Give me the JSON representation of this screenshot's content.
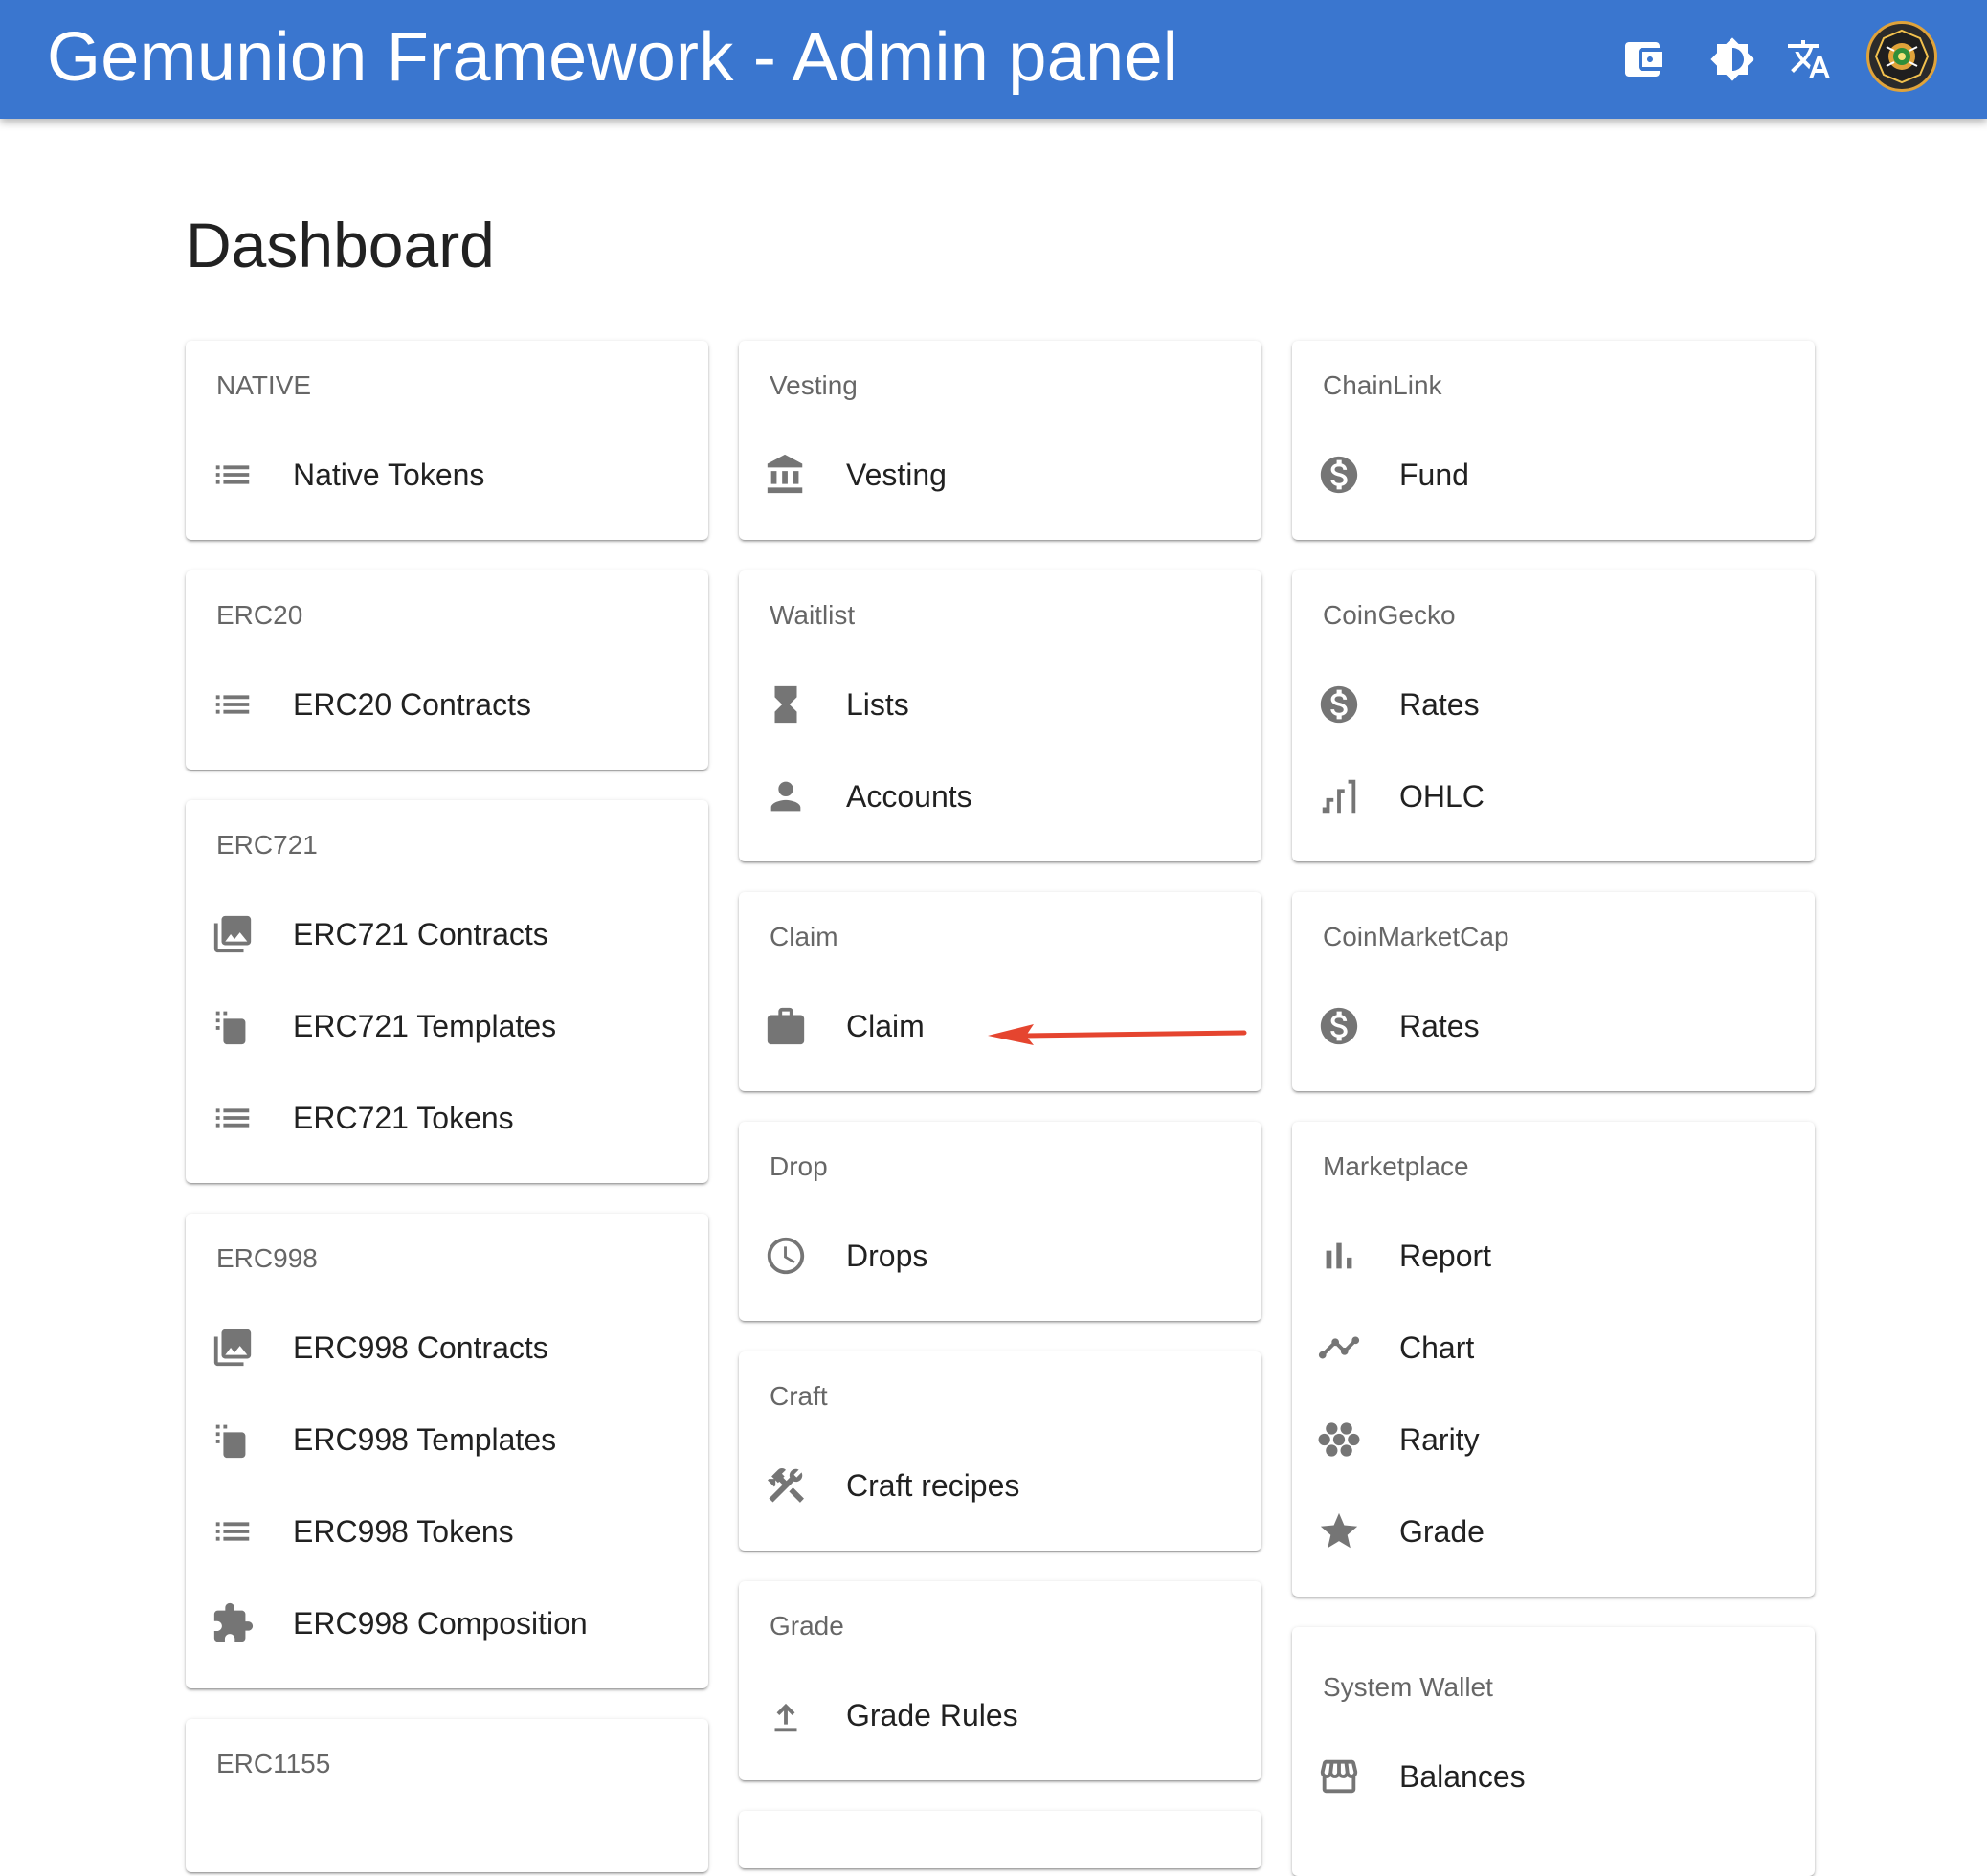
{
  "appbar": {
    "title": "Gemunion Framework - Admin panel",
    "icons": [
      "wallet-icon",
      "brightness-icon",
      "translate-icon",
      "logo-avatar"
    ]
  },
  "page": {
    "title": "Dashboard"
  },
  "annotation": {
    "arrow_color": "#e5452f",
    "points_to": "claim-item"
  },
  "columns": [
    [
      {
        "title": "NATIVE",
        "items": [
          {
            "label": "Native Tokens",
            "icon": "list-icon"
          }
        ]
      },
      {
        "title": "ERC20",
        "items": [
          {
            "label": "ERC20 Contracts",
            "icon": "list-icon"
          }
        ]
      },
      {
        "title": "ERC721",
        "items": [
          {
            "label": "ERC721 Contracts",
            "icon": "image-stack-icon"
          },
          {
            "label": "ERC721 Templates",
            "icon": "copy-icon"
          },
          {
            "label": "ERC721 Tokens",
            "icon": "list-icon"
          }
        ]
      },
      {
        "title": "ERC998",
        "items": [
          {
            "label": "ERC998 Contracts",
            "icon": "image-stack-icon"
          },
          {
            "label": "ERC998 Templates",
            "icon": "copy-icon"
          },
          {
            "label": "ERC998 Tokens",
            "icon": "list-icon"
          },
          {
            "label": "ERC998 Composition",
            "icon": "puzzle-icon"
          }
        ]
      },
      {
        "title": "ERC1155",
        "items": []
      }
    ],
    [
      {
        "title": "Vesting",
        "items": [
          {
            "label": "Vesting",
            "icon": "bank-icon"
          }
        ]
      },
      {
        "title": "Waitlist",
        "items": [
          {
            "label": "Lists",
            "icon": "hourglass-icon"
          },
          {
            "label": "Accounts",
            "icon": "person-icon"
          }
        ]
      },
      {
        "title": "Claim",
        "items": [
          {
            "label": "Claim",
            "icon": "redeem-icon"
          }
        ]
      },
      {
        "title": "Drop",
        "items": [
          {
            "label": "Drops",
            "icon": "clock-icon"
          }
        ]
      },
      {
        "title": "Craft",
        "items": [
          {
            "label": "Craft recipes",
            "icon": "tools-icon"
          }
        ]
      },
      {
        "title": "Grade",
        "items": [
          {
            "label": "Grade Rules",
            "icon": "upgrade-icon"
          }
        ]
      }
    ],
    [
      {
        "title": "ChainLink",
        "items": [
          {
            "label": "Fund",
            "icon": "dollar-icon"
          }
        ]
      },
      {
        "title": "CoinGecko",
        "items": [
          {
            "label": "Rates",
            "icon": "dollar-icon"
          },
          {
            "label": "OHLC",
            "icon": "candlestick-icon"
          }
        ]
      },
      {
        "title": "CoinMarketCap",
        "items": [
          {
            "label": "Rates",
            "icon": "dollar-icon"
          }
        ]
      },
      {
        "title": "Marketplace",
        "items": [
          {
            "label": "Report",
            "icon": "bar-chart-icon"
          },
          {
            "label": "Chart",
            "icon": "line-chart-icon"
          },
          {
            "label": "Rarity",
            "icon": "workspaces-icon"
          },
          {
            "label": "Grade",
            "icon": "star-icon"
          }
        ]
      },
      {
        "title": "System Wallet",
        "items": [
          {
            "label": "Balances",
            "icon": "store-icon"
          }
        ]
      }
    ]
  ]
}
